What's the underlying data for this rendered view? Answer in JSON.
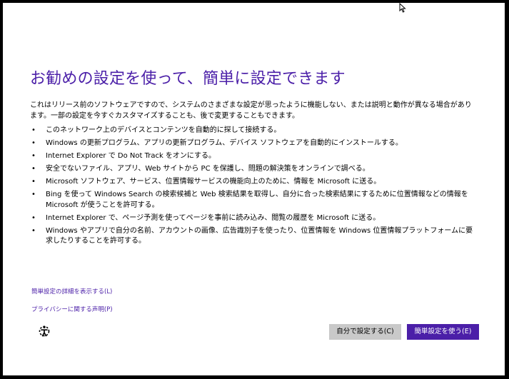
{
  "title": "お勧めの設定を使って、簡単に設定できます",
  "intro": "これはリリース前のソフトウェアですので、システムのさまざまな設定が思ったように機能しない、または説明と動作が異なる場合があります。一部の設定を今すぐカスタマイズすることも、後で変更することもできます。",
  "bullet_symbol": "•",
  "bullets": [
    "このネットワーク上のデバイスとコンテンツを自動的に探して接続する。",
    "Windows の更新プログラム、アプリの更新プログラム、デバイス ソフトウェアを自動的にインストールする。",
    "Internet Explorer で Do Not Track をオンにする。",
    "安全でないファイル、アプリ、Web サイトから PC を保護し、問題の解決策をオンラインで調べる。",
    "Microsoft ソフトウェア、サービス、位置情報サービスの機能向上のために、情報を Microsoft に送る。",
    "Bing を使って Windows Search の検索候補と Web 検索結果を取得し、自分に合った検索結果にするために位置情報などの情報を Microsoft が使うことを許可する。",
    "Internet Explorer で、ページ予測を使ってページを事前に読み込み、閲覧の履歴を Microsoft に送る。",
    "Windows やアプリで自分の名前、アカウントの画像、広告識別子を使ったり、位置情報を Windows 位置情報プラットフォームに要求したりすることを許可する。"
  ],
  "links": {
    "express_details": "簡単設定の詳細を表示する(L)",
    "privacy_statement": "プライバシーに関する声明(P)"
  },
  "buttons": {
    "customize": "自分で設定する(C)",
    "use_express": "簡単設定を使う(E)"
  },
  "icons": {
    "ease_of_access": "ease-of-access-icon",
    "cursor": "mouse-cursor-icon"
  },
  "colors": {
    "accent": "#4b1fa8",
    "background": "#ffffff",
    "frame": "#000000",
    "secondary_button": "#c9c9c9"
  }
}
